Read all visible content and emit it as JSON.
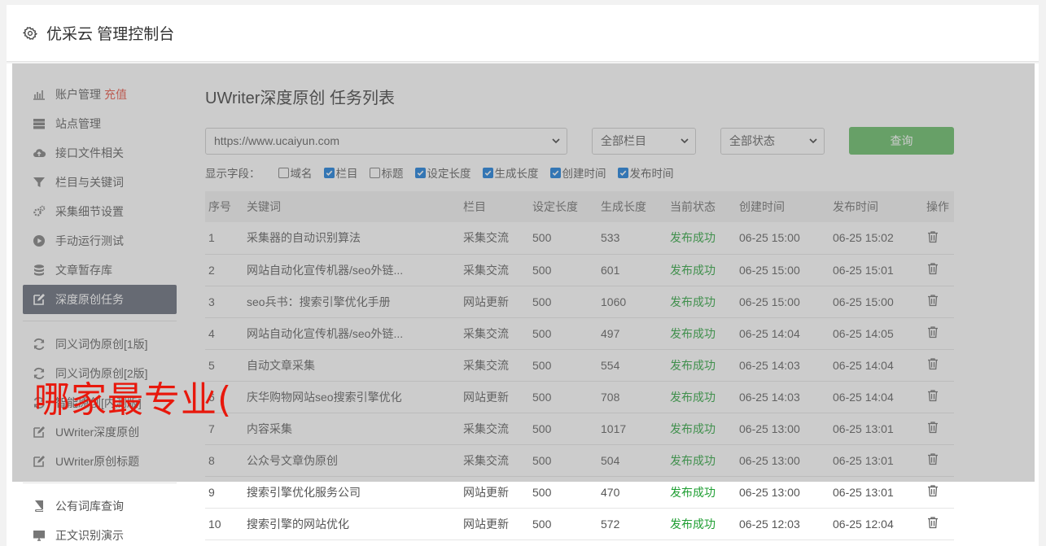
{
  "header": {
    "title": "优采云 管理控制台",
    "icon": "gear-icon"
  },
  "sidebar": {
    "group1": [
      {
        "label": "账户管理",
        "tag": "充值",
        "icon": "bar-chart-icon"
      },
      {
        "label": "站点管理",
        "icon": "server-icon"
      },
      {
        "label": "接口文件相关",
        "icon": "cloud-upload-icon"
      },
      {
        "label": "栏目与关键词",
        "icon": "filter-icon"
      },
      {
        "label": "采集细节设置",
        "icon": "gears-icon"
      },
      {
        "label": "手动运行测试",
        "icon": "play-circle-icon"
      },
      {
        "label": "文章暂存库",
        "icon": "database-icon"
      },
      {
        "label": "深度原创任务",
        "icon": "edit-icon",
        "active": true
      }
    ],
    "group2": [
      {
        "label": "同义词伪原创[1版]",
        "icon": "refresh-icon"
      },
      {
        "label": "同义词伪原创[2版]",
        "icon": "refresh-icon"
      },
      {
        "label": "智能原创[内测版]",
        "icon": "refresh-icon"
      },
      {
        "label": "UWriter深度原创",
        "icon": "edit-icon"
      },
      {
        "label": "UWriter原创标题",
        "icon": "edit-icon"
      }
    ],
    "group3": [
      {
        "label": "公有词库查询",
        "icon": "book-icon"
      },
      {
        "label": "正文识别演示",
        "icon": "monitor-icon"
      }
    ]
  },
  "main": {
    "title": "UWriter深度原创 任务列表",
    "filters": {
      "site": "https://www.ucaiyun.com",
      "column": "全部栏目",
      "status": "全部状态",
      "query_label": "查询"
    },
    "fields": {
      "label": "显示字段：",
      "items": [
        {
          "label": "域名",
          "checked": false
        },
        {
          "label": "栏目",
          "checked": true
        },
        {
          "label": "标题",
          "checked": false
        },
        {
          "label": "设定长度",
          "checked": true
        },
        {
          "label": "生成长度",
          "checked": true
        },
        {
          "label": "创建时间",
          "checked": true
        },
        {
          "label": "发布时间",
          "checked": true
        }
      ]
    },
    "table": {
      "headers": [
        "序号",
        "关键词",
        "栏目",
        "设定长度",
        "生成长度",
        "当前状态",
        "创建时间",
        "发布时间",
        "操作"
      ],
      "rows": [
        [
          "1",
          "采集器的自动识别算法",
          "采集交流",
          "500",
          "533",
          "发布成功",
          "06-25 15:00",
          "06-25 15:02"
        ],
        [
          "2",
          "网站自动化宣传机器/seo外链...",
          "采集交流",
          "500",
          "601",
          "发布成功",
          "06-25 15:00",
          "06-25 15:01"
        ],
        [
          "3",
          "seo兵书：搜索引擎优化手册",
          "网站更新",
          "500",
          "1060",
          "发布成功",
          "06-25 15:00",
          "06-25 15:00"
        ],
        [
          "4",
          "网站自动化宣传机器/seo外链...",
          "采集交流",
          "500",
          "497",
          "发布成功",
          "06-25 14:04",
          "06-25 14:05"
        ],
        [
          "5",
          "自动文章采集",
          "采集交流",
          "500",
          "554",
          "发布成功",
          "06-25 14:03",
          "06-25 14:04"
        ],
        [
          "6",
          "庆华购物网站seo搜索引擎优化",
          "网站更新",
          "500",
          "708",
          "发布成功",
          "06-25 14:03",
          "06-25 14:04"
        ],
        [
          "7",
          "内容采集",
          "采集交流",
          "500",
          "1017",
          "发布成功",
          "06-25 13:00",
          "06-25 13:01"
        ],
        [
          "8",
          "公众号文章伪原创",
          "采集交流",
          "500",
          "504",
          "发布成功",
          "06-25 13:00",
          "06-25 13:01"
        ],
        [
          "9",
          "搜索引擎优化服务公司",
          "网站更新",
          "500",
          "470",
          "发布成功",
          "06-25 13:00",
          "06-25 13:01"
        ],
        [
          "10",
          "搜索引擎的网站优化",
          "网站更新",
          "500",
          "572",
          "发布成功",
          "06-25 12:03",
          "06-25 12:04"
        ]
      ]
    }
  },
  "watermark": "哪家最专业(",
  "colors": {
    "active_nav": "#5b6270",
    "query_button": "#5cb85c",
    "status_ok": "#1e9e32",
    "tag": "#e64d3d"
  }
}
